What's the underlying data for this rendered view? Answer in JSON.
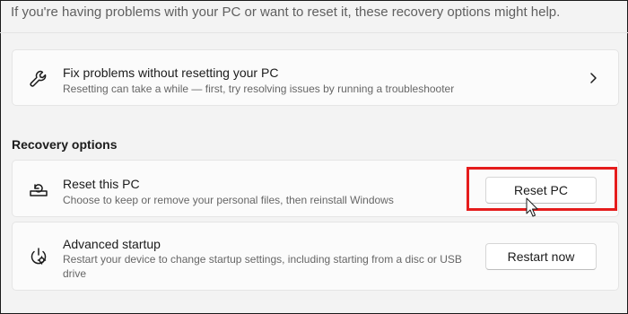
{
  "intro_text": "If you're having problems with your PC or want to reset it, these recovery options might help.",
  "fix_card": {
    "title": "Fix problems without resetting your PC",
    "description": "Resetting can take a while — first, try resolving issues by running a troubleshooter",
    "icon": "wrench-icon",
    "action_icon": "chevron-right-icon"
  },
  "recovery_section": {
    "label": "Recovery options",
    "reset": {
      "title": "Reset this PC",
      "description": "Choose to keep or remove your personal files, then reinstall Windows",
      "button_label": "Reset PC",
      "icon": "reset-pc-icon"
    },
    "advanced": {
      "title": "Advanced startup",
      "description": "Restart your device to change startup settings, including starting from a disc or USB drive",
      "button_label": "Restart now",
      "icon": "advanced-startup-icon"
    }
  },
  "annotation": {
    "highlight_color": "#e51c1c"
  },
  "colors": {
    "background": "#f3f3f3",
    "card": "#fbfbfb",
    "text": "#1b1b1b",
    "secondary_text": "#666666"
  }
}
